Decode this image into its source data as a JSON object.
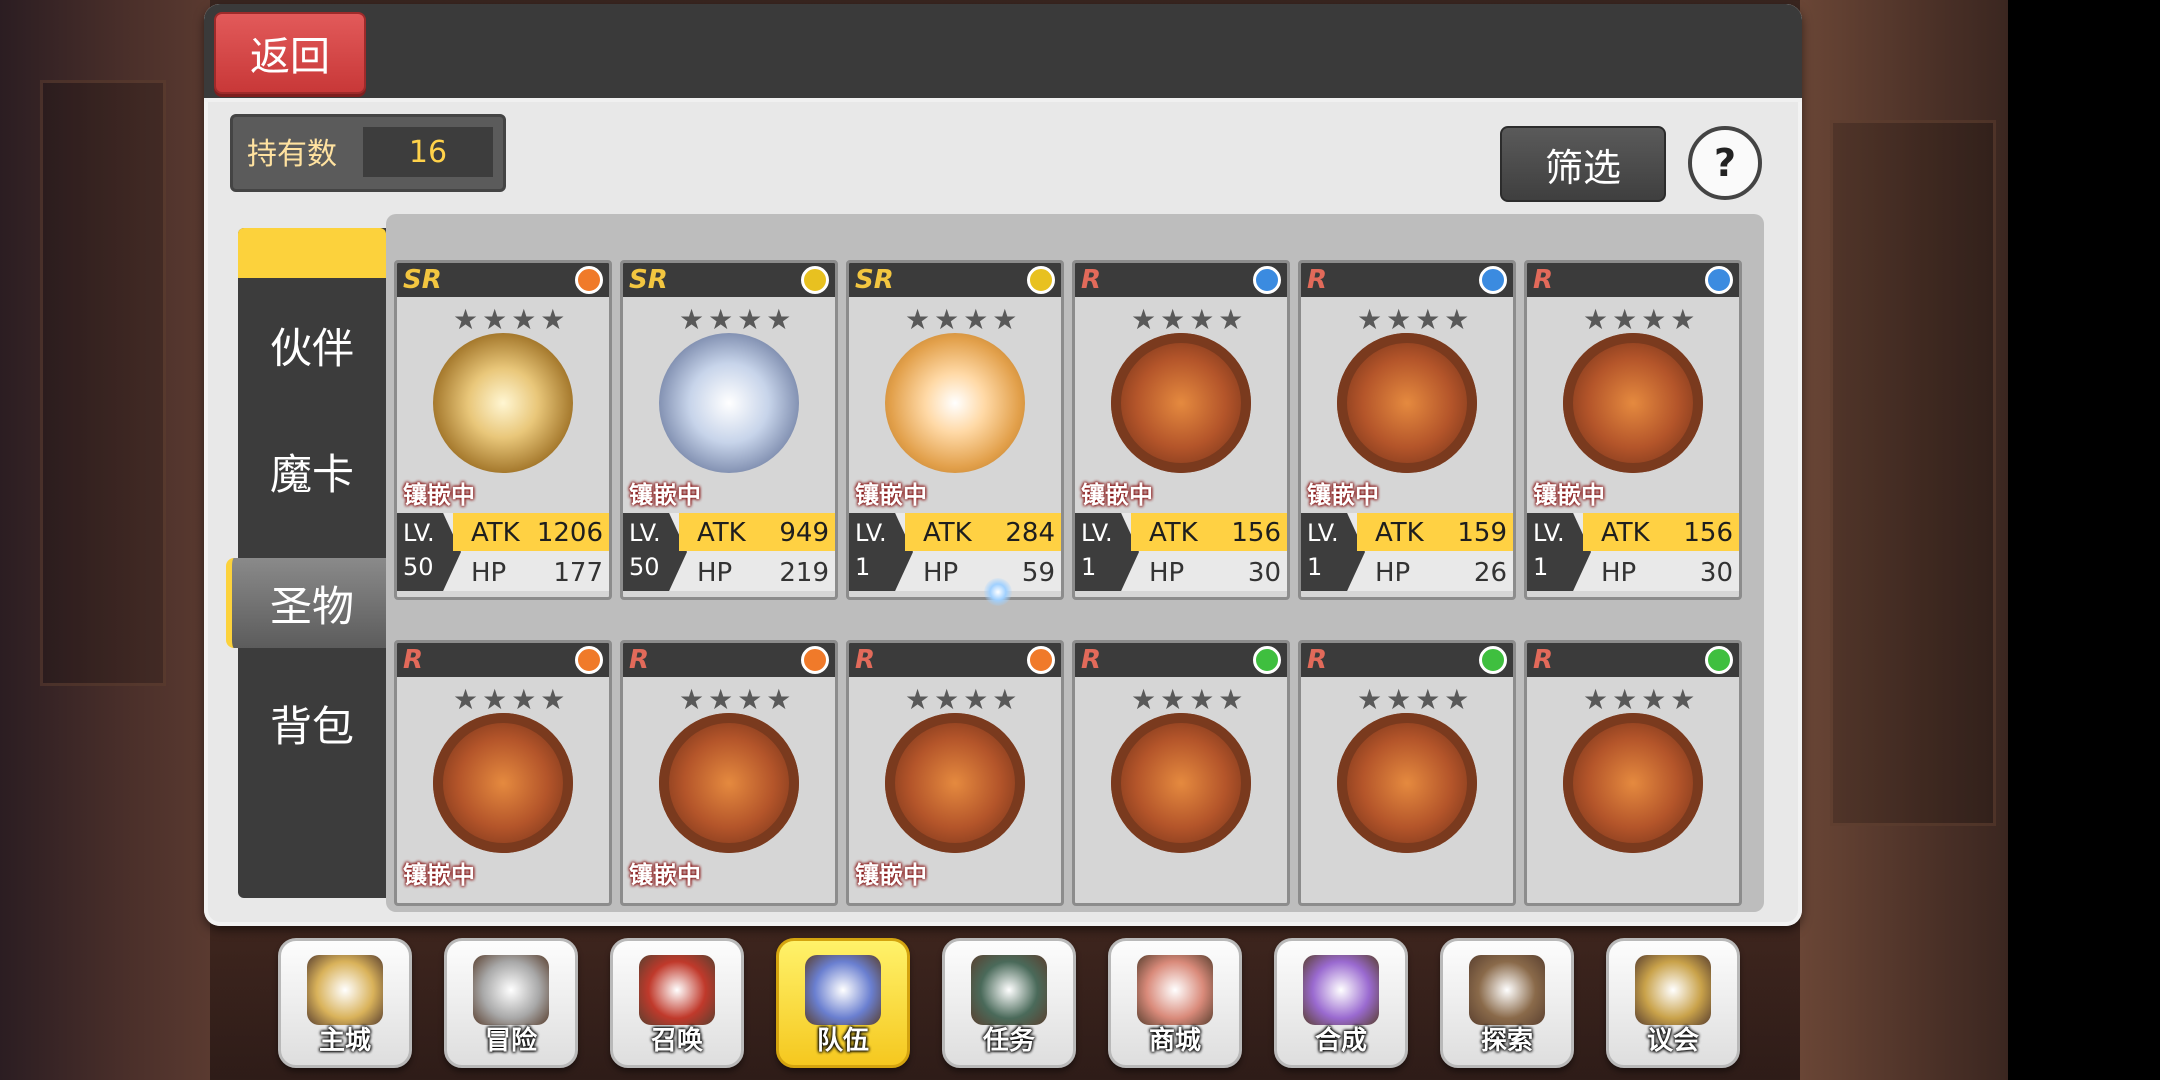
{
  "header": {
    "back_label": "返回"
  },
  "owned": {
    "label": "持有数",
    "value": "16"
  },
  "toolbar": {
    "filter_label": "筛选",
    "help_label": "?"
  },
  "tabs": [
    {
      "label": "伙伴"
    },
    {
      "label": "魔卡"
    },
    {
      "label": "圣物",
      "active": true
    },
    {
      "label": "背包"
    }
  ],
  "cards": [
    {
      "rarity": "SR",
      "element_color": "#f07a2a",
      "art": "gold-shield",
      "stars": "★★★★",
      "status": "镶嵌中",
      "lv_label": "LV.",
      "lv": "50",
      "atk_label": "ATK",
      "atk": "1206",
      "hp_label": "HP",
      "hp": "177"
    },
    {
      "rarity": "SR",
      "element_color": "#e8c120",
      "art": "silver-wings",
      "stars": "★★★★",
      "status": "镶嵌中",
      "lv_label": "LV.",
      "lv": "50",
      "atk_label": "ATK",
      "atk": "949",
      "hp_label": "HP",
      "hp": "219"
    },
    {
      "rarity": "SR",
      "element_color": "#e8c120",
      "art": "laurel-crest",
      "stars": "★★★★",
      "status": "镶嵌中",
      "lv_label": "LV.",
      "lv": "1",
      "atk_label": "ATK",
      "atk": "284",
      "hp_label": "HP",
      "hp": "59"
    },
    {
      "rarity": "R",
      "element_color": "#3b8be0",
      "art": "bronze-dragon",
      "stars": "★★★★",
      "status": "镶嵌中",
      "lv_label": "LV.",
      "lv": "1",
      "atk_label": "ATK",
      "atk": "156",
      "hp_label": "HP",
      "hp": "30"
    },
    {
      "rarity": "R",
      "element_color": "#3b8be0",
      "art": "bronze-croc",
      "stars": "★★★★",
      "status": "镶嵌中",
      "lv_label": "LV.",
      "lv": "1",
      "atk_label": "ATK",
      "atk": "159",
      "hp_label": "HP",
      "hp": "26"
    },
    {
      "rarity": "R",
      "element_color": "#3b8be0",
      "art": "bronze-turtle",
      "stars": "★★★★",
      "status": "镶嵌中",
      "lv_label": "LV.",
      "lv": "1",
      "atk_label": "ATK",
      "atk": "156",
      "hp_label": "HP",
      "hp": "30"
    },
    {
      "rarity": "R",
      "element_color": "#f07a2a",
      "art": "bronze-beast",
      "stars": "★★★★",
      "status": "镶嵌中"
    },
    {
      "rarity": "R",
      "element_color": "#f07a2a",
      "art": "bronze-bird",
      "stars": "★★★★",
      "status": "镶嵌中"
    },
    {
      "rarity": "R",
      "element_color": "#f07a2a",
      "art": "bronze-wolf",
      "stars": "★★★★",
      "status": "镶嵌中"
    },
    {
      "rarity": "R",
      "element_color": "#3fbf3f",
      "art": "bronze-knight",
      "stars": "★★★★",
      "status": ""
    },
    {
      "rarity": "R",
      "element_color": "#3fbf3f",
      "art": "bronze-golem",
      "stars": "★★★★",
      "status": ""
    },
    {
      "rarity": "R",
      "element_color": "#3fbf3f",
      "art": "bronze-fox",
      "stars": "★★★★",
      "status": ""
    }
  ],
  "nav": [
    {
      "label": "主城",
      "icon": "crown-icon"
    },
    {
      "label": "冒险",
      "icon": "crossed-swords-icon"
    },
    {
      "label": "召唤",
      "icon": "summon-card-icon"
    },
    {
      "label": "队伍",
      "icon": "winged-shield-icon",
      "active": true
    },
    {
      "label": "任务",
      "icon": "quest-book-icon"
    },
    {
      "label": "商城",
      "icon": "shop-tree-icon"
    },
    {
      "label": "合成",
      "icon": "potion-icon"
    },
    {
      "label": "探索",
      "icon": "shovel-icon"
    },
    {
      "label": "议会",
      "icon": "council-emblem-icon"
    }
  ]
}
